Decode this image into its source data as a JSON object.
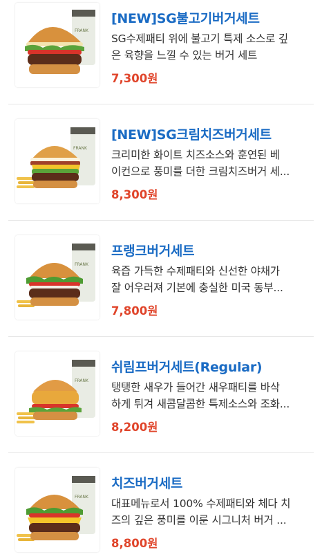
{
  "colors": {
    "title": "#1a6bc4",
    "price": "#e0452b",
    "text": "#333333",
    "divider": "#e6e6e6"
  },
  "items": [
    {
      "title": "[NEW]SG불고기버거세트",
      "desc_line1": "SG수제패티 위에 불고기 특제 소스로 깊",
      "desc_line2": "은 육향을 느낄 수 있는 버거 세트",
      "price": "7,300원",
      "image_icon": "bulgogi-burger-set-photo",
      "cup_text": "FRANK"
    },
    {
      "title": "[NEW]SG크림치즈버거세트",
      "desc_line1": "크리미한 화이트 치즈소스와 훈연된 베",
      "desc_line2": "이컨으로 풍미를 더한 크림치즈버거 세...",
      "price": "8,300원",
      "image_icon": "cream-cheese-burger-set-photo",
      "cup_text": "FRANK"
    },
    {
      "title": "프랭크버거세트",
      "desc_line1": "육즙 가득한 수제패티와 신선한 야채가",
      "desc_line2": "잘 어우러져 기본에 충실한 미국 동부...",
      "price": "7,800원",
      "image_icon": "frank-burger-set-photo",
      "cup_text": "FRANK"
    },
    {
      "title": "쉬림프버거세트(Regular)",
      "desc_line1": "탱탱한 새우가 들어간 새우패티를 바삭",
      "desc_line2": "하게 튀겨 새콤달콤한 특제소스와 조화...",
      "price": "8,200원",
      "image_icon": "shrimp-burger-set-photo",
      "cup_text": "FRANK"
    },
    {
      "title": "치즈버거세트",
      "desc_line1": "대표메뉴로서 100% 수제패티와 체다 치",
      "desc_line2": "즈의 깊은 풍미를 이룬 시그니처 버거 ...",
      "price": "8,800원",
      "image_icon": "cheese-burger-set-photo",
      "cup_text": "FRANK"
    }
  ]
}
